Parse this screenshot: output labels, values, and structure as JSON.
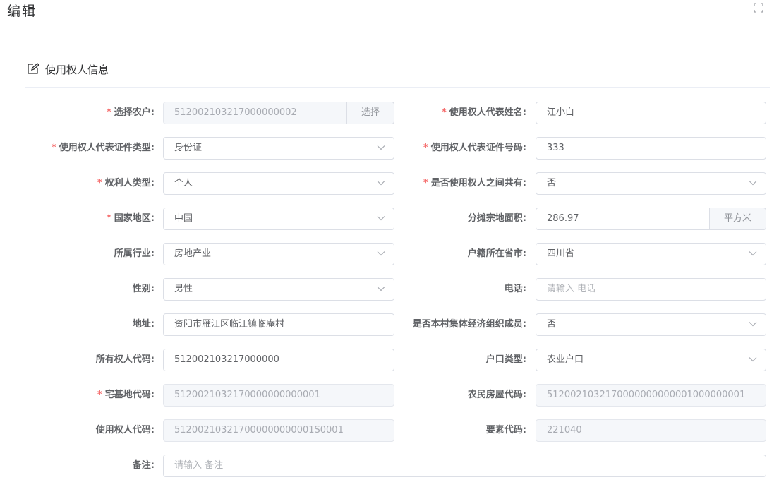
{
  "header": {
    "title": "编辑"
  },
  "section": {
    "title": "使用权人信息"
  },
  "fields": {
    "farmer": {
      "label": "选择农户:",
      "value": "512002103217000000002",
      "button": "选择"
    },
    "rep_name": {
      "label": "使用权人代表姓名:",
      "value": "江小白"
    },
    "id_type": {
      "label": "使用权人代表证件类型:",
      "value": "身份证"
    },
    "id_number": {
      "label": "使用权人代表证件号码:",
      "value": "333"
    },
    "holder_type": {
      "label": "权利人类型:",
      "value": "个人"
    },
    "shared": {
      "label": "是否使用权人之间共有:",
      "value": "否"
    },
    "country": {
      "label": "国家地区:",
      "value": "中国"
    },
    "area": {
      "label": "分摊宗地面积:",
      "value": "286.97",
      "unit": "平方米"
    },
    "industry": {
      "label": "所属行业:",
      "value": "房地产业"
    },
    "province": {
      "label": "户籍所在省市:",
      "value": "四川省"
    },
    "gender": {
      "label": "性别:",
      "value": "男性"
    },
    "phone": {
      "label": "电话:",
      "placeholder": "请输入 电话"
    },
    "address": {
      "label": "地址:",
      "value": "资阳市雁江区临江镇临庵村"
    },
    "member": {
      "label": "是否本村集体经济组织成员:",
      "value": "否"
    },
    "owner_code": {
      "label": "所有权人代码:",
      "value": "512002103217000000"
    },
    "hukou_type": {
      "label": "户口类型:",
      "value": "农业户口"
    },
    "homestead_code": {
      "label": "宅基地代码:",
      "value": "5120021032170000000000001"
    },
    "house_code": {
      "label": "农民房屋代码:",
      "value": "5120021032170000000000001000000001"
    },
    "user_code": {
      "label": "使用权人代码:",
      "value": "512002103217000000000001S0001"
    },
    "element_code": {
      "label": "要素代码:",
      "value": "221040"
    },
    "remark": {
      "label": "备注:",
      "placeholder": "请输入 备注"
    }
  }
}
